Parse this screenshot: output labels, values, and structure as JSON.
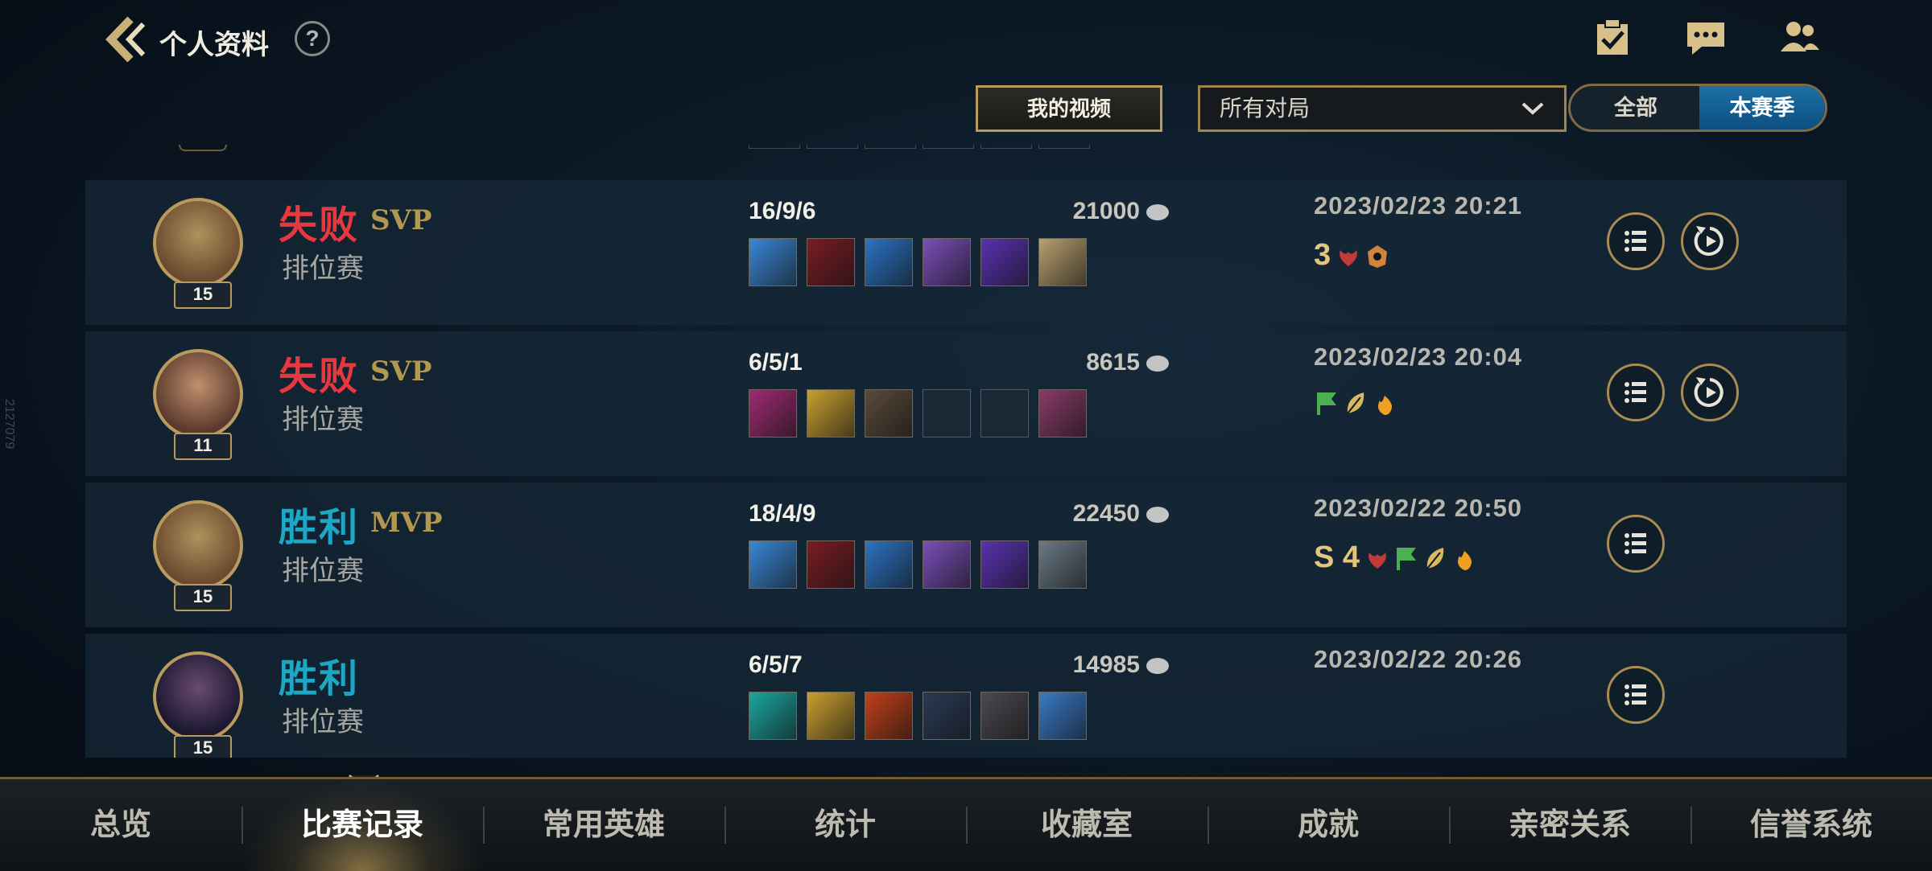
{
  "header": {
    "title": "个人资料",
    "help": "?",
    "icons": [
      "checklist-icon",
      "chat-icon",
      "friends-icon"
    ]
  },
  "filters": {
    "video_button": "我的视频",
    "match_type_selected": "所有对局",
    "season_options": [
      "全部",
      "本赛季"
    ],
    "season_selected": "本赛季"
  },
  "side_code": "2127079",
  "matches": [
    {
      "result": "失败",
      "win": false,
      "badge": "SVP",
      "mode": "排位赛",
      "level": "15",
      "kda": "16/9/6",
      "gold": "21000",
      "items": [
        "#3a88d8",
        "#7a1c24",
        "#2b74c4",
        "#7a4fb8",
        "#5a32b0",
        "#b8a070"
      ],
      "date": "2023/02/23 20:21",
      "honor_text": "3",
      "honor_icons": [
        "lotus-icon",
        "crest-icon"
      ],
      "replay": true
    },
    {
      "result": "失败",
      "win": false,
      "badge": "SVP",
      "mode": "排位赛",
      "level": "11",
      "kda": "6/5/1",
      "gold": "8615",
      "items": [
        "#a02a72",
        "#c9a030",
        "#5a4a3a",
        "",
        "",
        "#8a3a6a"
      ],
      "date": "2023/02/23 20:04",
      "honor_text": "",
      "honor_icons": [
        "flag-icon",
        "leaf-icon",
        "flame-icon"
      ],
      "replay": true
    },
    {
      "result": "胜利",
      "win": true,
      "badge": "MVP",
      "mode": "排位赛",
      "level": "15",
      "kda": "18/4/9",
      "gold": "22450",
      "items": [
        "#3a88d8",
        "#7a1c24",
        "#2b74c4",
        "#7a4fb8",
        "#5a32b0",
        "#6a7a86"
      ],
      "date": "2023/02/22 20:50",
      "honor_text": "S 4",
      "honor_icons": [
        "lotus-icon",
        "flag-icon",
        "leaf-icon",
        "flame-icon"
      ],
      "replay": false
    },
    {
      "result": "胜利",
      "win": true,
      "badge": "",
      "mode": "排位赛",
      "level": "15",
      "kda": "6/5/7",
      "gold": "14985",
      "items": [
        "#1aa6a0",
        "#c9a030",
        "#c2401a",
        "#2a3a56",
        "#4a4a50",
        "#3a7ac8"
      ],
      "date": "2023/02/22 20:26",
      "honor_text": "",
      "honor_icons": [],
      "replay": false
    }
  ],
  "tabs": [
    "总览",
    "比赛记录",
    "常用英雄",
    "统计",
    "收藏室",
    "成就",
    "亲密关系",
    "信誉系统"
  ],
  "active_tab": "比赛记录",
  "colors": {
    "lose": "#e8383f",
    "win": "#1ea7c5",
    "gold_accent": "#b99a5e",
    "season_active": "#1d6fa6"
  }
}
